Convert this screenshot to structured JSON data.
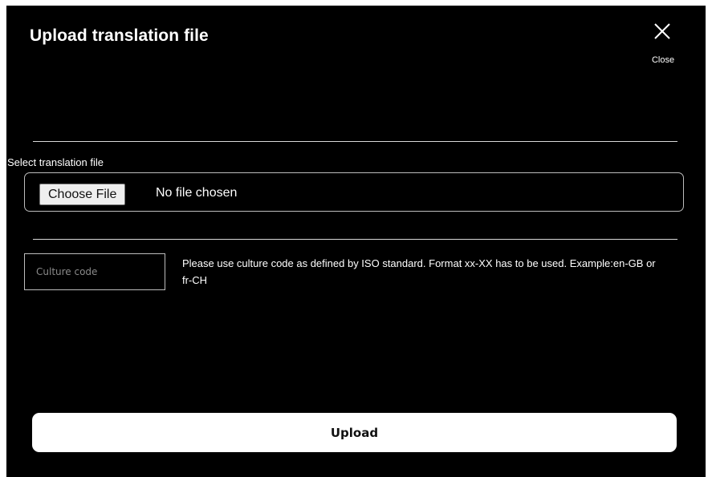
{
  "dialog": {
    "title": "Upload translation file",
    "close_label": "Close",
    "close_icon": "close-icon"
  },
  "file_section": {
    "label": "Select translation file",
    "choose_button": "Choose File",
    "status": "No file chosen"
  },
  "culture": {
    "placeholder": "Culture code",
    "value": "",
    "help_text": "Please use culture code as defined by ISO standard. Format xx-XX has to be used. Example:en-GB or fr-CH"
  },
  "actions": {
    "upload_label": "Upload"
  },
  "colors": {
    "background": "#000000",
    "text": "#ffffff",
    "button_bg": "#ffffff",
    "button_text": "#111111",
    "divider": "#d9d9d9"
  }
}
